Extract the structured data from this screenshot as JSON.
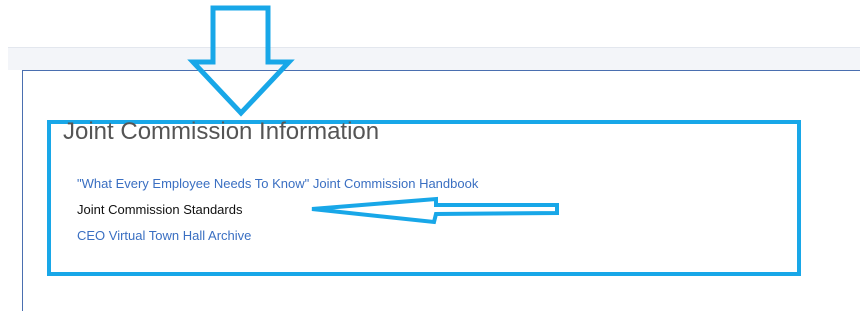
{
  "section": {
    "title": "Joint Commission Information",
    "links": [
      {
        "label": "\"What Every Employee Needs To Know\" Joint Commission Handbook"
      },
      {
        "label": "Joint Commission Standards"
      },
      {
        "label": "CEO Virtual Town Hall Archive"
      }
    ]
  },
  "colors": {
    "annotation": "#18a7e8",
    "link": "#3a6fc2",
    "highlighted_link": "#111111",
    "frame": "#4a6fb0"
  },
  "annotations": {
    "down_arrow_icon": "arrow-down-icon",
    "left_arrow_icon": "arrow-left-icon"
  }
}
